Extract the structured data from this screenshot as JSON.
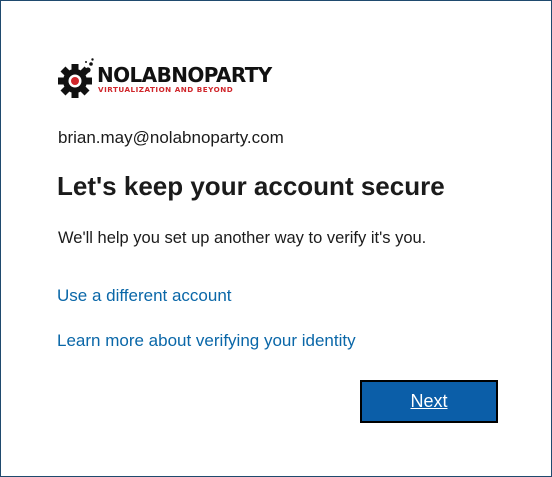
{
  "logo": {
    "name": "NOLABNOPARTY",
    "tagline": "VIRTUALIZATION AND BEYOND",
    "icon": "gear-icon",
    "colors": {
      "gear": "#111111",
      "accent": "#d0262b"
    }
  },
  "account": {
    "email": "brian.may@nolabnoparty.com"
  },
  "heading": "Let's keep your account secure",
  "description": "We'll help you set up another way to verify it's you.",
  "links": {
    "different_account": "Use a different account",
    "learn_more": "Learn more about verifying your identity"
  },
  "actions": {
    "next_label": "Next"
  },
  "colors": {
    "link": "#0a67a8",
    "primary_button": "#0b5ea8",
    "text": "#1b1b1b"
  }
}
